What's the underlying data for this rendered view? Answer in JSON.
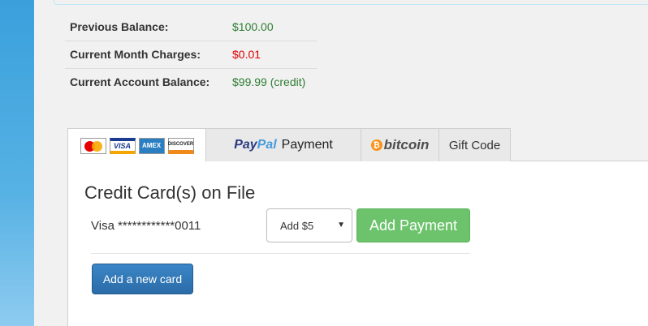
{
  "balances": [
    {
      "label": "Previous Balance:",
      "value": "$100.00",
      "color": "#2e7d32"
    },
    {
      "label": "Current Month Charges:",
      "value": "$0.01",
      "color": "#e00000"
    },
    {
      "label": "Current Account Balance:",
      "value": "$99.99 (credit)",
      "color": "#2e7d32"
    }
  ],
  "tabs": {
    "cards": {
      "mastercard": "MasterCard",
      "visa": "VISA",
      "amex": "AMEX",
      "discover": "DISCOVER"
    },
    "paypal": {
      "pay": "Pay",
      "pal": "Pal",
      "payment": "Payment"
    },
    "bitcoin": {
      "symbol": "₿",
      "label": "bitcoin"
    },
    "gift": "Gift Code"
  },
  "main": {
    "title": "Credit Card(s) on File",
    "card_on_file": "Visa ************0011",
    "amount_select": {
      "selected": "Add $5",
      "arrow": "▼"
    },
    "add_payment_label": "Add Payment",
    "add_new_card_label": "Add a new card"
  }
}
